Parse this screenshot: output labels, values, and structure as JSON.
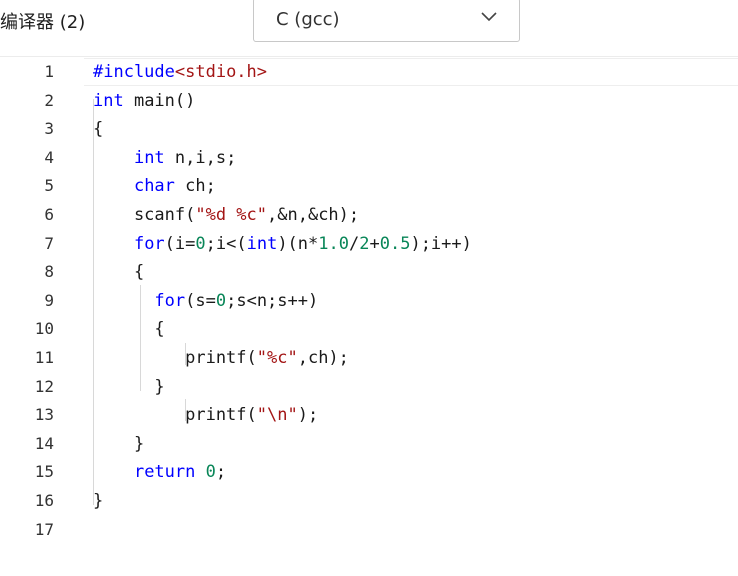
{
  "toolbar": {
    "compiler_label": "编译器 (2)",
    "compiler_select": {
      "value": "C (gcc)",
      "icon": "chevron-down-icon"
    }
  },
  "editor": {
    "line_numbers": [
      "1",
      "2",
      "3",
      "4",
      "5",
      "6",
      "7",
      "8",
      "9",
      "10",
      "11",
      "12",
      "13",
      "14",
      "15",
      "16",
      "17"
    ],
    "lines": [
      [
        {
          "t": "#include",
          "c": "kw"
        },
        {
          "t": "<stdio.h>",
          "c": "str"
        }
      ],
      [
        {
          "t": "int",
          "c": "kw"
        },
        {
          "t": " main()",
          "c": ""
        }
      ],
      [
        {
          "t": "{",
          "c": ""
        }
      ],
      [
        {
          "t": "    ",
          "c": ""
        },
        {
          "t": "int",
          "c": "kw"
        },
        {
          "t": " n,i,s;",
          "c": ""
        }
      ],
      [
        {
          "t": "    ",
          "c": ""
        },
        {
          "t": "char",
          "c": "kw"
        },
        {
          "t": " ch;",
          "c": ""
        }
      ],
      [
        {
          "t": "    scanf(",
          "c": ""
        },
        {
          "t": "\"%d %c\"",
          "c": "str"
        },
        {
          "t": ",&n,&ch);",
          "c": ""
        }
      ],
      [
        {
          "t": "    ",
          "c": ""
        },
        {
          "t": "for",
          "c": "kw"
        },
        {
          "t": "(i=",
          "c": ""
        },
        {
          "t": "0",
          "c": "num"
        },
        {
          "t": ";i<(",
          "c": ""
        },
        {
          "t": "int",
          "c": "kw"
        },
        {
          "t": ")(n*",
          "c": ""
        },
        {
          "t": "1.0",
          "c": "num"
        },
        {
          "t": "/",
          "c": ""
        },
        {
          "t": "2",
          "c": "num"
        },
        {
          "t": "+",
          "c": ""
        },
        {
          "t": "0.5",
          "c": "num"
        },
        {
          "t": ");i++)",
          "c": ""
        }
      ],
      [
        {
          "t": "    {",
          "c": ""
        }
      ],
      [
        {
          "t": "      ",
          "c": ""
        },
        {
          "t": "for",
          "c": "kw"
        },
        {
          "t": "(s=",
          "c": ""
        },
        {
          "t": "0",
          "c": "num"
        },
        {
          "t": ";s<n;s++)",
          "c": ""
        }
      ],
      [
        {
          "t": "      {",
          "c": ""
        }
      ],
      [
        {
          "t": "         printf(",
          "c": ""
        },
        {
          "t": "\"%c\"",
          "c": "str"
        },
        {
          "t": ",ch);",
          "c": ""
        }
      ],
      [
        {
          "t": "      }",
          "c": ""
        }
      ],
      [
        {
          "t": "         printf(",
          "c": ""
        },
        {
          "t": "\"\\n\"",
          "c": "str"
        },
        {
          "t": ");",
          "c": ""
        }
      ],
      [
        {
          "t": "    }",
          "c": ""
        }
      ],
      [
        {
          "t": "    ",
          "c": ""
        },
        {
          "t": "return",
          "c": "kw"
        },
        {
          "t": " ",
          "c": ""
        },
        {
          "t": "0",
          "c": "num"
        },
        {
          "t": ";",
          "c": ""
        }
      ],
      [
        {
          "t": "}",
          "c": ""
        }
      ],
      []
    ],
    "current_line": 1
  },
  "colors": {
    "keyword": "#0000ff",
    "string": "#a31515",
    "number": "#098658",
    "text": "#1a1a1a",
    "line_number": "#333333"
  }
}
